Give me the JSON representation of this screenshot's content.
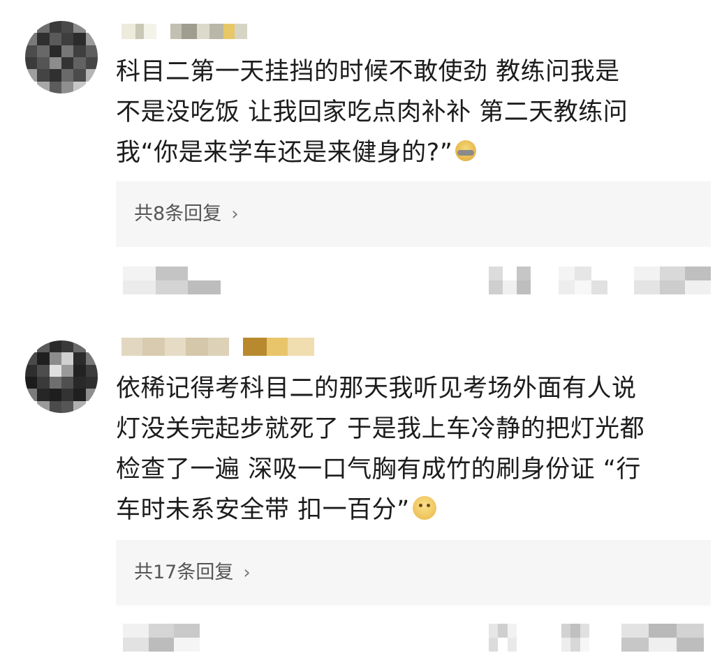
{
  "comments": [
    {
      "avatar_icon": "pixelated-avatar-icon",
      "username_icon": "pixelated-username",
      "text_lines": [
        "科目二第一天挂挡的时候不敢使劲 教练问我是",
        "不是没吃饭 让我回家吃点肉补补 第二天教练问",
        "我“你是来学车还是来健身的?”"
      ],
      "emoji": "sweat-smile-emoji-icon",
      "reply_label": "共8条回复",
      "reply_chevron": "›"
    },
    {
      "avatar_icon": "pixelated-avatar-icon",
      "username_icon": "pixelated-username",
      "text_lines": [
        "依稀记得考科目二的那天我听见考场外面有人说",
        "灯没关完起步就死了 于是我上车冷静的把灯光都",
        "检查了一遍 深吸一口气胸有成竹的刷身份证 “行",
        "车时未系安全带 扣一百分”"
      ],
      "emoji": "grin-emoji-icon",
      "reply_label": "共17条回复",
      "reply_chevron": "›"
    }
  ],
  "colors": {
    "reply_background": "#f6f6f6",
    "reply_text": "#555555",
    "comment_text": "#1c1c1c"
  }
}
